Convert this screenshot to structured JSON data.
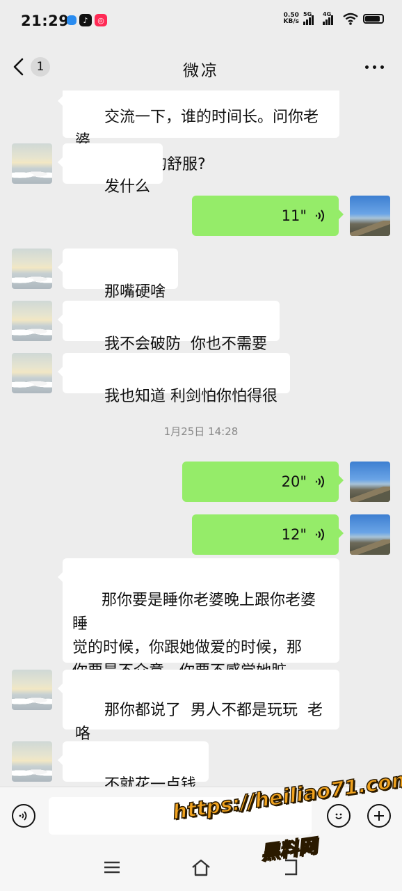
{
  "status_bar": {
    "time": "21:29",
    "net_speed_value": "0.50",
    "net_speed_unit": "KB/s",
    "sim1_label": "5G",
    "sim2_label": "4G",
    "battery_level": 0.8,
    "app_icons": [
      "cloud-app-icon",
      "tiktok-icon",
      "red-app-icon"
    ]
  },
  "header": {
    "unread_count": "1",
    "title": "微凉"
  },
  "messages": [
    {
      "side": "in",
      "type": "text",
      "text": "交流一下，谁的时间长。问你老婆\n玩的，谁玩的舒服?",
      "avatar": "cloud-avatar"
    },
    {
      "side": "in",
      "type": "text",
      "text": "发什么",
      "avatar": "cloud-avatar"
    },
    {
      "side": "out",
      "type": "voice",
      "duration": "11\"",
      "avatar": "mountain-avatar"
    },
    {
      "side": "in",
      "type": "text",
      "text": "那嘴硬啥",
      "avatar": "cloud-avatar"
    },
    {
      "side": "in",
      "type": "text",
      "text": "我不会破防  你也不需要",
      "avatar": "cloud-avatar"
    },
    {
      "side": "in",
      "type": "text",
      "text": "我也知道 利剑怕你怕得很",
      "avatar": "cloud-avatar"
    },
    {
      "side": "out",
      "type": "voice",
      "duration": "20\"",
      "avatar": "mountain-avatar"
    },
    {
      "side": "out",
      "type": "voice",
      "duration": "12\"",
      "avatar": "mountain-avatar"
    },
    {
      "side": "in",
      "type": "text",
      "text": "那你要是睡你老婆晚上跟你老婆睡\n觉的时候，你跟她做爱的时候，那\n你要是不介意，你要不感觉她脏，\n那别人不能咋说你是不是?",
      "avatar": "none"
    },
    {
      "side": "in",
      "type": "text",
      "text": "那你都说了  男人不都是玩玩  老咯\n换一个就是咯",
      "avatar": "cloud-avatar"
    },
    {
      "side": "in",
      "type": "text",
      "text": "不就花一点钱",
      "avatar": "cloud-avatar"
    }
  ],
  "timestamp": "1月25日 14:28",
  "input_bar": {
    "value": "",
    "placeholder": ""
  },
  "watermark": {
    "url": "https://heiliao71.com",
    "name": "黑料网"
  },
  "colors": {
    "background": "#ededed",
    "incoming_bubble": "#ffffff",
    "outgoing_bubble": "#95ec69",
    "watermark": "#f0a21e"
  }
}
